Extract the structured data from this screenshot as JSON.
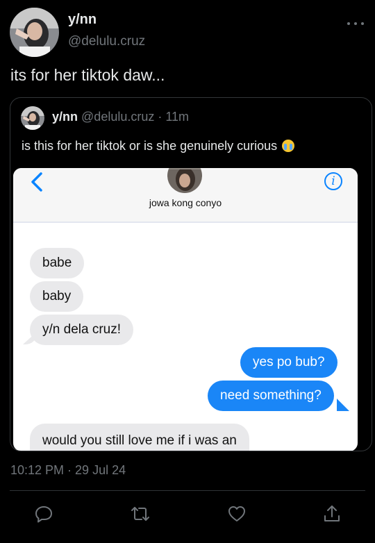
{
  "tweet": {
    "display_name": "y/nn",
    "handle": "@delulu.cruz",
    "text": "its for her tiktok daw...",
    "timestamp": "10:12 PM · 29 Jul 24"
  },
  "quoted_tweet": {
    "display_name": "y/nn",
    "handle_time": "@delulu.cruz · 11m",
    "text": "is this for her tiktok or is she genuinely curious",
    "emoji": "loudly-crying-face-icon"
  },
  "chat": {
    "contact_name": "jowa kong conyo",
    "messages": [
      {
        "from": "them",
        "text": "babe"
      },
      {
        "from": "them",
        "text": "baby"
      },
      {
        "from": "them",
        "text": "y/n dela cruz!"
      },
      {
        "from": "me",
        "text": "yes po bub?"
      },
      {
        "from": "me",
        "text": "need something?"
      },
      {
        "from": "them",
        "text": "would you still love me if i was an"
      }
    ]
  },
  "icons": {
    "more": "more-icon",
    "reply": "reply-icon",
    "retweet": "retweet-icon",
    "like": "heart-icon",
    "share": "share-icon",
    "back": "chevron-left-icon",
    "info": "info-icon"
  },
  "colors": {
    "background": "#000000",
    "text_primary": "#e7e9ea",
    "text_secondary": "#71767b",
    "imessage_blue": "#1a86f7",
    "imessage_gray": "#e9e9eb",
    "link_blue": "#0a84ff"
  }
}
